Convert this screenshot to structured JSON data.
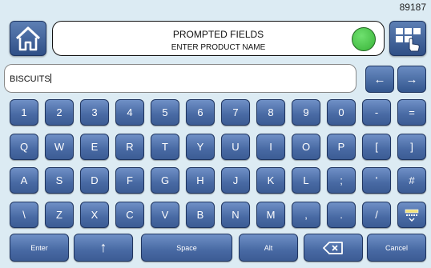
{
  "serial": "89187",
  "header": {
    "title": "PROMPTED FIELDS",
    "subtitle": "ENTER PRODUCT NAME",
    "status_color": "#38b338"
  },
  "entry": {
    "value": "BISCUITS"
  },
  "arrows": {
    "left": "←",
    "right": "→"
  },
  "rows": [
    [
      "1",
      "2",
      "3",
      "4",
      "5",
      "6",
      "7",
      "8",
      "9",
      "0",
      "-",
      "="
    ],
    [
      "Q",
      "W",
      "E",
      "R",
      "T",
      "Y",
      "U",
      "I",
      "O",
      "P",
      "[",
      "]"
    ],
    [
      "A",
      "S",
      "D",
      "F",
      "G",
      "H",
      "J",
      "K",
      "L",
      ";",
      "'",
      "#"
    ],
    [
      "\\",
      "Z",
      "X",
      "C",
      "V",
      "B",
      "N",
      "M",
      ",",
      ".",
      "/"
    ]
  ],
  "bottom": {
    "enter": "Enter",
    "shift": "↑",
    "space": "Space",
    "alt": "Alt",
    "cancel": "Cancel"
  },
  "icons": {
    "home": "home-icon",
    "menu": "grid-menu-icon",
    "backspace": "backspace-icon",
    "keyboard_switch": "keyboard-switch-icon"
  }
}
